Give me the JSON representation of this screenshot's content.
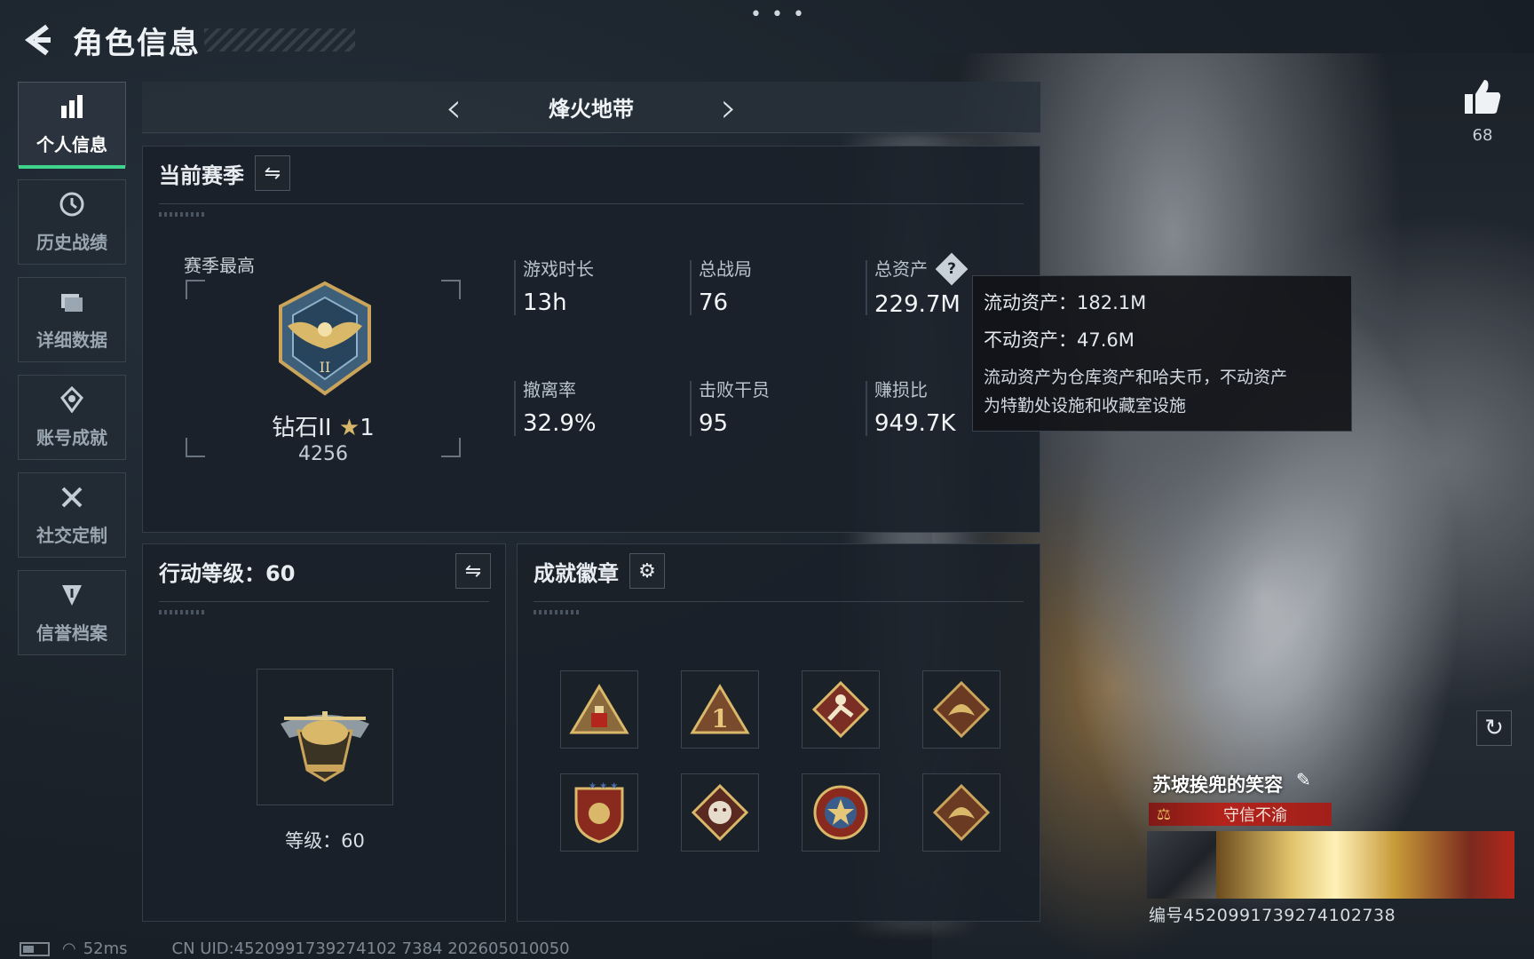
{
  "header": {
    "title": "角色信息"
  },
  "nav": [
    {
      "label": "个人信息",
      "icon": "bar-chart-icon",
      "active": true
    },
    {
      "label": "历史战绩",
      "icon": "history-icon"
    },
    {
      "label": "详细数据",
      "icon": "folder-icon"
    },
    {
      "label": "账号成就",
      "icon": "achievement-icon"
    },
    {
      "label": "社交定制",
      "icon": "tools-icon"
    },
    {
      "label": "信誉档案",
      "icon": "credit-icon"
    }
  ],
  "mode": {
    "title": "烽火地带"
  },
  "season": {
    "title": "当前赛季",
    "best_label": "赛季最高",
    "rank_name": "钻石II",
    "rank_stars": "1",
    "rank_score": "4256",
    "stats": [
      {
        "label": "游戏时长",
        "value": "13h"
      },
      {
        "label": "总战局",
        "value": "76"
      },
      {
        "label": "总资产",
        "value": "229.7M",
        "help": true
      },
      {
        "label": "撤离率",
        "value": "32.9%"
      },
      {
        "label": "击败干员",
        "value": "95"
      },
      {
        "label": "赚损比",
        "value": "949.7K"
      }
    ]
  },
  "tooltip": {
    "liquid": "流动资产：182.1M",
    "fixed": "不动资产：47.6M",
    "note_1": "流动资产为仓库资产和哈夫币，不动资产",
    "note_2": "为特勤处设施和收藏室设施"
  },
  "level": {
    "title": "行动等级：60",
    "level_text": "等级：60"
  },
  "badges": {
    "title": "成就徽章",
    "items": [
      "triangle-badge-icon",
      "number-one-badge-icon",
      "runner-badge-icon",
      "dragon-badge-icon",
      "shield-badge-icon",
      "beast-badge-icon",
      "star-badge-icon",
      "dragon-badge-icon"
    ]
  },
  "like": {
    "count": "68"
  },
  "card": {
    "name": "苏坡挨兜的笑容",
    "honor": "守信不渝",
    "uid": "编号4520991739274102738"
  },
  "footer": {
    "ping": "52ms",
    "uid_line": "CN UID:4520991739274102 7384 202605010050"
  },
  "colors": {
    "accent": "#3fd38c",
    "honor_red": "#b3231c",
    "gold": "#d7b86a"
  }
}
